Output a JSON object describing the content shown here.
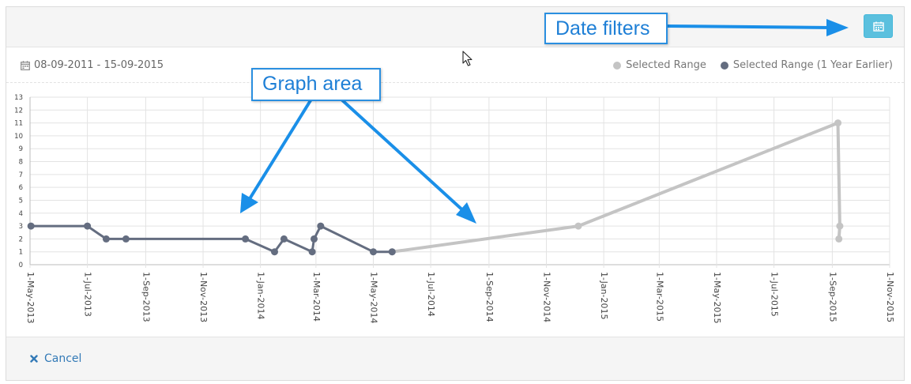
{
  "header": {
    "calendar_button_icon": "calendar-icon"
  },
  "range": {
    "date_range": "08-09-2011 - 15-09-2015",
    "date_icon": "calendar-icon"
  },
  "legend": {
    "items": [
      {
        "label": "Selected Range",
        "color": "#c4c4c4"
      },
      {
        "label": "Selected Range (1 Year Earlier)",
        "color": "#646d80"
      }
    ]
  },
  "footer": {
    "cancel_label": "Cancel",
    "cancel_icon": "close-icon"
  },
  "annotations": {
    "graph_area": "Graph area",
    "date_filters": "Date filters"
  },
  "colors": {
    "accent_button": "#5bc0de",
    "callout_blue": "#1e7fd6",
    "arrow_blue": "#1a8fe8",
    "link_blue": "#337ab7"
  },
  "chart_data": {
    "type": "line",
    "xlim": [
      "2013-05-01",
      "2015-11-01"
    ],
    "ylim": [
      0,
      13
    ],
    "grid": true,
    "legend_placement": "top-right",
    "x_ticks": [
      "1-May-2013",
      "1-Jul-2013",
      "1-Sep-2013",
      "1-Nov-2013",
      "1-Jan-2014",
      "1-Mar-2014",
      "1-May-2014",
      "1-Jul-2014",
      "1-Sep-2014",
      "1-Nov-2014",
      "1-Jan-2015",
      "1-Mar-2015",
      "1-May-2015",
      "1-Jul-2015",
      "1-Sep-2015",
      "1-Nov-2015"
    ],
    "y_ticks": [
      0,
      1,
      2,
      3,
      4,
      5,
      6,
      7,
      8,
      9,
      10,
      11,
      12,
      13
    ],
    "series": [
      {
        "name": "Selected Range (1 Year Earlier)",
        "color": "#646d80",
        "points": [
          {
            "x": "2013-05-02",
            "y": 3
          },
          {
            "x": "2013-07-01",
            "y": 3
          },
          {
            "x": "2013-07-21",
            "y": 2
          },
          {
            "x": "2013-08-11",
            "y": 2
          },
          {
            "x": "2013-12-16",
            "y": 2
          },
          {
            "x": "2014-01-16",
            "y": 1
          },
          {
            "x": "2014-01-26",
            "y": 2
          },
          {
            "x": "2014-02-25",
            "y": 1
          },
          {
            "x": "2014-02-27",
            "y": 2
          },
          {
            "x": "2014-03-06",
            "y": 3
          },
          {
            "x": "2014-05-01",
            "y": 1
          },
          {
            "x": "2014-05-21",
            "y": 1
          }
        ]
      },
      {
        "name": "Selected Range",
        "color": "#c4c4c4",
        "points": [
          {
            "x": "2014-05-21",
            "y": 1
          },
          {
            "x": "2014-12-05",
            "y": 3
          },
          {
            "x": "2015-09-07",
            "y": 11
          },
          {
            "x": "2015-09-09",
            "y": 3
          },
          {
            "x": "2015-09-08",
            "y": 2
          }
        ]
      }
    ]
  }
}
